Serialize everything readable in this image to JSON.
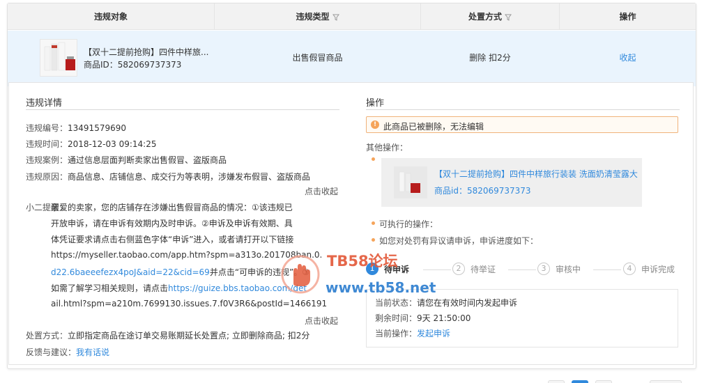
{
  "table": {
    "headers": {
      "target": "违规对象",
      "type": "违规类型",
      "method": "处置方式",
      "action": "操作"
    },
    "row": {
      "title": "【双十二提前抢购】四件中样旅...",
      "product_id_label": "商品ID：",
      "product_id": "582069737373",
      "violation_type": "出售假冒商品",
      "disposal": "删除 扣2分",
      "collapse_link": "收起"
    }
  },
  "details": {
    "title": "违规详情",
    "fields": [
      {
        "key": "违规编号：",
        "value": "13491579690"
      },
      {
        "key": "违规时间：",
        "value": "2018-12-03 09:14:25"
      },
      {
        "key": "违规案例：",
        "value": "通过信息层面判断卖家出售假冒、盗版商品"
      },
      {
        "key": "违规原因：",
        "value": "商品信息、店铺信息、成交行为等表明，涉嫌发布假冒、盗版商品"
      }
    ],
    "collapse_1": "点击收起",
    "tip_label": "小二提醒：",
    "tip_lines": [
      "亲爱的卖家，您的店铺存在涉嫌出售假冒商品的情况：①该违规已",
      "开放申诉，请在申诉有效期内及时申诉。②申诉及申诉有效期、具",
      "体凭证要求请点击右侧蓝色字体“申诉”进入，或者请打开以下链接"
    ],
    "tip_link_1a": "https://myseller.taobao.com/app.htm?spm=a313o.201708ban.0.",
    "tip_link_1b": "d22.6baeeefezx4poJ&aid=22&cid=69",
    "tip_after_link_1": "并点击“可申诉的违规”。③",
    "tip_line_before_2": "如需了解学习相关规则，请点击",
    "tip_link_2a": "https://guize.bbs.taobao.com/det",
    "tip_link_2b": "ail.html?spm=a210m.7699130.issues.7.f0V3R6&postId=1466191",
    "collapse_2": "点击收起",
    "disposal_key": "处置方式：",
    "disposal_value": "立即指定商品在途订单交易账期延长处置点; 立即删除商品; 扣2分",
    "feedback_key": "反馈与建议：",
    "feedback_link": "我有话说"
  },
  "operations": {
    "title": "操作",
    "notice": "此商品已被删除，无法编辑",
    "other_ops": "其他操作：",
    "card_title": "【双十二提前抢购】四件中样旅行装装 洗面奶清莹露大",
    "card_id_label": "商品id：",
    "card_id": "582069737373",
    "executable": "可执行的操作：",
    "appeal_hint": "如您对处罚有异议请申诉，申诉进度如下：",
    "steps": [
      {
        "num": "1",
        "label": "待申诉"
      },
      {
        "num": "2",
        "label": "待举证"
      },
      {
        "num": "3",
        "label": "审核中"
      },
      {
        "num": "4",
        "label": "申诉完成"
      }
    ],
    "status": {
      "current_key": "当前状态：",
      "current_value": "请您在有效时间内发起申诉",
      "remaining_key": "剩余时间：",
      "remaining_value": "9天 21:50:00",
      "op_key": "当前操作：",
      "op_link": "发起申诉"
    }
  },
  "watermark": {
    "title": "TB58论坛",
    "url": "www.tb58.net"
  },
  "colors": {
    "link": "#3089dc",
    "header_bg": "#f2f2f2",
    "row_bg": "#eaf4fd",
    "notice_border": "#f0b27a",
    "bullet": "#f5a45a"
  }
}
